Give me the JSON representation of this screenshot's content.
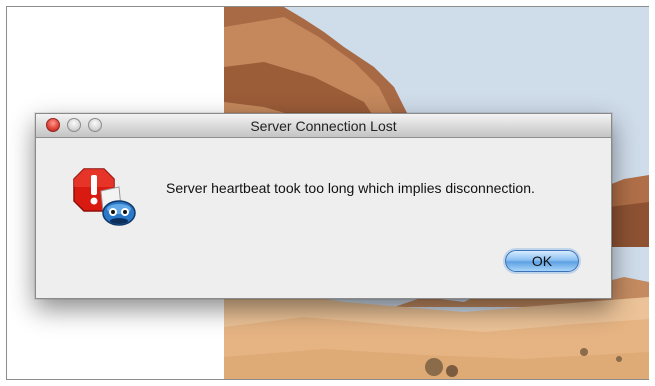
{
  "dialog": {
    "title": "Server Connection Lost",
    "message": "Server heartbeat took too long which implies disconnection.",
    "icon": "alert-stop-icon",
    "ok_label": "OK"
  },
  "colors": {
    "accent_button": "#6aa8e6",
    "close_light": "#e2463a",
    "alert_red": "#d81a10"
  }
}
